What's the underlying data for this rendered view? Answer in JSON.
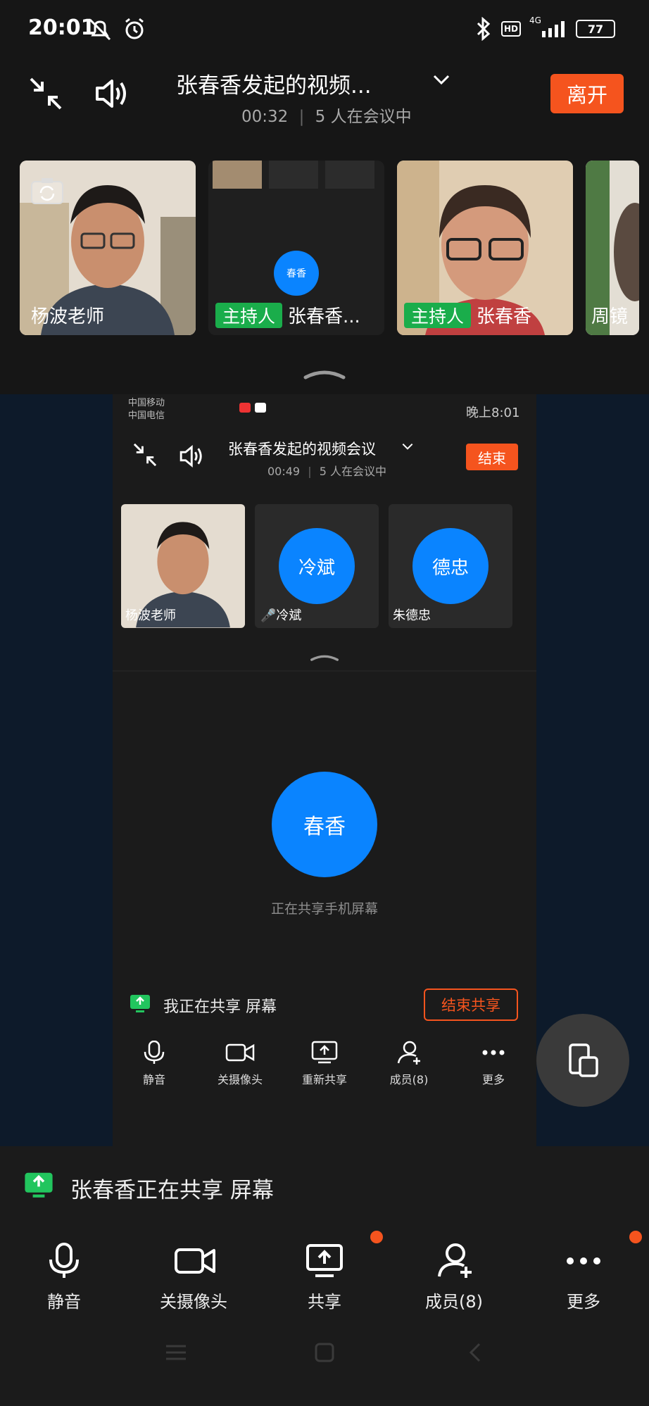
{
  "status_bar": {
    "time": "20:01",
    "battery": "77",
    "network": "4G",
    "hd": "HD"
  },
  "header": {
    "title": "张春香发起的视频...",
    "elapsed": "00:32",
    "separator": "|",
    "participants": "5 人在会议中",
    "leave_label": "离开"
  },
  "thumbnails": [
    {
      "name": "杨波老师",
      "host": false
    },
    {
      "name": "张春香...",
      "host": true,
      "host_label": "主持人",
      "avatar_text": "春香"
    },
    {
      "name": "张春香",
      "host": true,
      "host_label": "主持人"
    },
    {
      "name": "周镜"
    }
  ],
  "shared_screen": {
    "status_left_1": "中国移动",
    "status_left_2": "中国电信",
    "status_time": "晚上8:01",
    "title": "张春香发起的视频会议",
    "elapsed": "00:49",
    "separator": "|",
    "participants": "5 人在会议中",
    "end_label": "结束",
    "participants_list": [
      {
        "name": "杨波老师"
      },
      {
        "name": "冷斌",
        "avatar_text": "冷斌"
      },
      {
        "name": "朱德忠",
        "avatar_text": "德忠"
      }
    ],
    "main_avatar_text": "春香",
    "sharing_text": "正在共享手机屏幕",
    "banner_text": "我正在共享 屏幕",
    "stop_share_label": "结束共享",
    "toolbar": [
      {
        "label": "静音",
        "icon": "mic-icon"
      },
      {
        "label": "关摄像头",
        "icon": "camera-icon"
      },
      {
        "label": "重新共享",
        "icon": "share-icon"
      },
      {
        "label": "成员(8)",
        "icon": "members-icon"
      },
      {
        "label": "更多",
        "icon": "more-icon"
      }
    ]
  },
  "share_banner": {
    "text": "张春香正在共享 屏幕"
  },
  "toolbar": [
    {
      "label": "静音",
      "icon": "mic-icon",
      "badge": false
    },
    {
      "label": "关摄像头",
      "icon": "camera-icon",
      "badge": false
    },
    {
      "label": "共享",
      "icon": "share-screen-icon",
      "badge": true
    },
    {
      "label": "成员(8)",
      "icon": "add-member-icon",
      "badge": false
    },
    {
      "label": "更多",
      "icon": "more-icon",
      "badge": true
    }
  ],
  "colors": {
    "accent_orange": "#f5541e",
    "host_green": "#1aad4b",
    "avatar_blue": "#0a84ff",
    "share_green": "#22c55e"
  }
}
